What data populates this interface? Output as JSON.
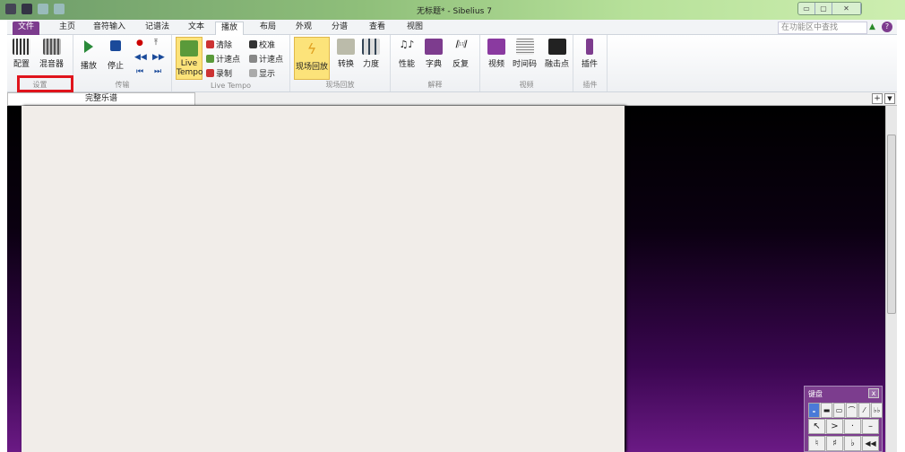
{
  "window": {
    "title": "无标题* - Sibelius 7",
    "controls": [
      "▭",
      "▢",
      "✕"
    ]
  },
  "tabs": [
    "文件",
    "主页",
    "音符输入",
    "记谱法",
    "文本",
    "播放",
    "布局",
    "外观",
    "分谱",
    "查看",
    "视图"
  ],
  "active_tab": "播放",
  "search": {
    "placeholder": "在功能区中查找"
  },
  "ribbon": {
    "setup": {
      "label": "设置",
      "buttons": [
        "配置",
        "混音器"
      ]
    },
    "transport": {
      "label": "传输",
      "buttons": [
        "播放",
        "停止"
      ]
    },
    "livetempo": {
      "label": "Live Tempo",
      "big": "Live Tempo",
      "small": [
        "清除",
        "计速点",
        "录制",
        "校准",
        "计速点",
        "显示"
      ]
    },
    "liveplayback": {
      "label": "现场回放",
      "buttons": [
        "现场回放",
        "转换",
        "力度"
      ]
    },
    "interpretation": {
      "label": "解释",
      "buttons": [
        "性能",
        "字典",
        "反复"
      ]
    },
    "video": {
      "label": "视频",
      "buttons": [
        "视频",
        "时间码",
        "融击点"
      ]
    },
    "plugins": {
      "label": "插件",
      "buttons": [
        "插件"
      ]
    }
  },
  "document_tab": "完整乐谱",
  "keypad": {
    "title": "键盘",
    "close": "x",
    "row1": [
      "𝅝",
      "▬",
      "▭",
      "⌒",
      "⁄",
      "♭♭"
    ],
    "row2": [
      "↖",
      ">",
      "·",
      "–"
    ],
    "row3": [
      "♮",
      "♯",
      "♭",
      "◀◀"
    ]
  }
}
